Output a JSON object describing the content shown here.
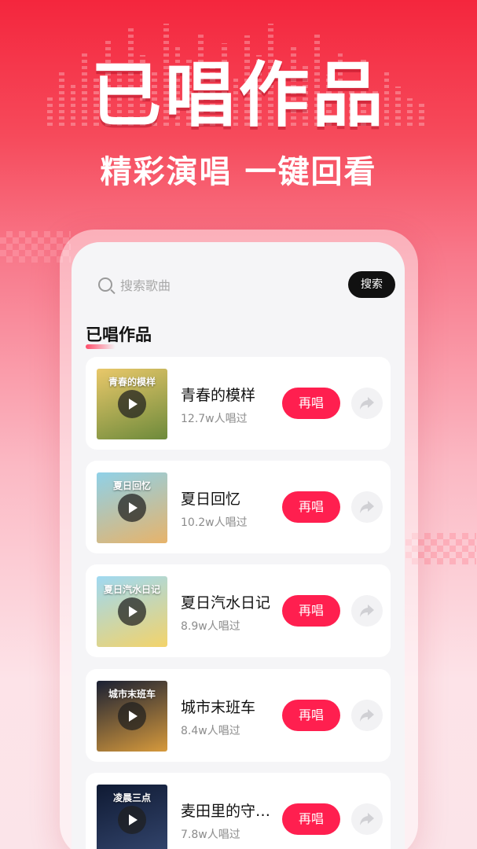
{
  "hero": {
    "title": "已唱作品",
    "subtitle": "精彩演唱 一键回看"
  },
  "search": {
    "placeholder": "搜索歌曲",
    "button_label": "搜索",
    "icon": "search-icon"
  },
  "section": {
    "title": "已唱作品"
  },
  "songs": [
    {
      "name": "青春的模样",
      "count": "12.7w人唱过",
      "cover_caption": "青春的模样",
      "action_label": "再唱",
      "cover_colors": [
        "#e9c86a",
        "#6d8a3b"
      ]
    },
    {
      "name": "夏日回忆",
      "count": "10.2w人唱过",
      "cover_caption": "夏日回忆",
      "action_label": "再唱",
      "cover_colors": [
        "#8fd1e8",
        "#e7b36a"
      ]
    },
    {
      "name": "夏日汽水日记",
      "count": "8.9w人唱过",
      "cover_caption": "夏日汽水日记",
      "action_label": "再唱",
      "cover_colors": [
        "#9fd9f2",
        "#f3d36a"
      ]
    },
    {
      "name": "城市末班车",
      "count": "8.4w人唱过",
      "cover_caption": "城市末班车",
      "action_label": "再唱",
      "cover_colors": [
        "#1a2033",
        "#d79a3c"
      ]
    },
    {
      "name": "麦田里的守…",
      "count": "7.8w人唱过",
      "cover_caption": "凌晨三点",
      "action_label": "再唱",
      "cover_colors": [
        "#0f1a33",
        "#34466e"
      ]
    }
  ],
  "colors": {
    "brand_red": "#ff1f4f",
    "hero_red": "#f4263d"
  }
}
